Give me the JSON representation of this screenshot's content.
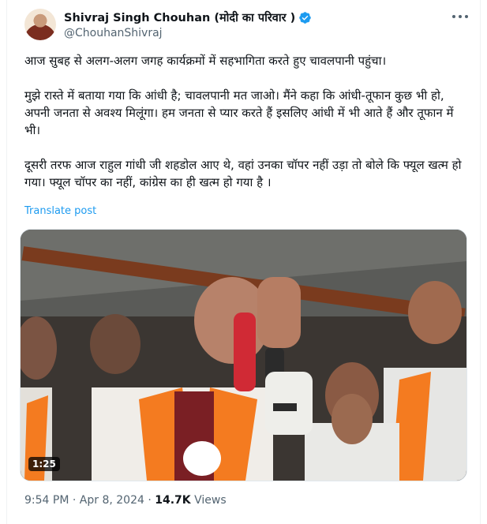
{
  "author": {
    "name": "Shivraj Singh Chouhan (मोदी का परिवार )",
    "handle": "@ChouhanShivraj"
  },
  "tweet": {
    "paragraphs": [
      "आज सुबह से अलग-अलग जगह कार्यक्रमों में सहभागिता करते हुए चावलपानी पहुंचा।",
      "मुझे रास्ते में बताया गया कि आंधी है; चावलपानी मत जाओ। मैंने कहा कि आंधी-तूफान कुछ भी हो, अपनी जनता से अवश्य मिलूंगा। हम जनता से प्यार करते हैं इसलिए आंधी में भी आते हैं और तूफान में भी।",
      "दूसरी तरफ आज राहुल गांधी जी शहडोल आए थे, वहां उनका चॉपर नहीं उड़ा तो बोले कि फ्यूल खत्म हो गया। फ्यूल चॉपर का नहीं, कांग्रेस का ही खत्म हो गया है ।"
    ],
    "translate_label": "Translate post"
  },
  "media": {
    "duration": "1:25"
  },
  "meta": {
    "time": "9:54 PM",
    "date": "Apr 8, 2024",
    "separator": "·",
    "views_count": "14.7K",
    "views_label": "Views"
  },
  "colors": {
    "accent": "#1d9bf0",
    "secondary_text": "#536471",
    "saffron": "#f47b20"
  },
  "icons": [
    "verified-badge-icon",
    "more-options-icon"
  ]
}
